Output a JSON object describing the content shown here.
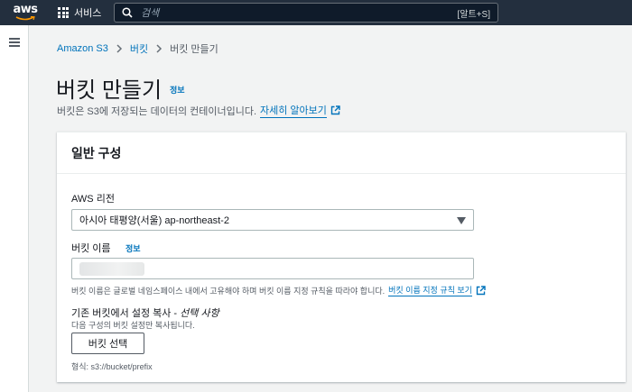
{
  "topnav": {
    "logo_text": "aws",
    "services_label": "서비스",
    "search_placeholder": "검색",
    "search_shortcut": "[알트+S]",
    "colors": {
      "background": "#232f3e",
      "logo_smile": "#ff9900"
    }
  },
  "breadcrumb": {
    "items": [
      {
        "label": "Amazon S3",
        "link": true
      },
      {
        "label": "버킷",
        "link": true
      },
      {
        "label": "버킷 만들기",
        "link": false
      }
    ],
    "separator_icon": "chevron-right-icon"
  },
  "page": {
    "title": "버킷 만들기",
    "info_label": "정보",
    "description": "버킷은 S3에 저장되는 데이터의 컨테이너입니다.",
    "learn_more": "자세히 알아보기",
    "accent_color": "#0073bb"
  },
  "general": {
    "title": "일반 구성",
    "region": {
      "label": "AWS 리전",
      "value": "아시아 태평양(서울) ap-northeast-2"
    },
    "bucket_name": {
      "label": "버킷 이름",
      "info_label": "정보",
      "value": "",
      "constraint_text": "버킷 이름은 글로벌 네임스페이스 내에서 고유해야 하며 버킷 이름 지정 규칙을 따라야 합니다.",
      "rules_link": "버킷 이름 지정 규칙 보기"
    },
    "copy_settings": {
      "label": "기존 버킷에서 설정 복사 -",
      "optional": "선택 사항",
      "description": "다음 구성의 버킷 설정만 복사됩니다.",
      "button_label": "버킷 선택",
      "format_hint": "형식: s3://bucket/prefix"
    }
  }
}
